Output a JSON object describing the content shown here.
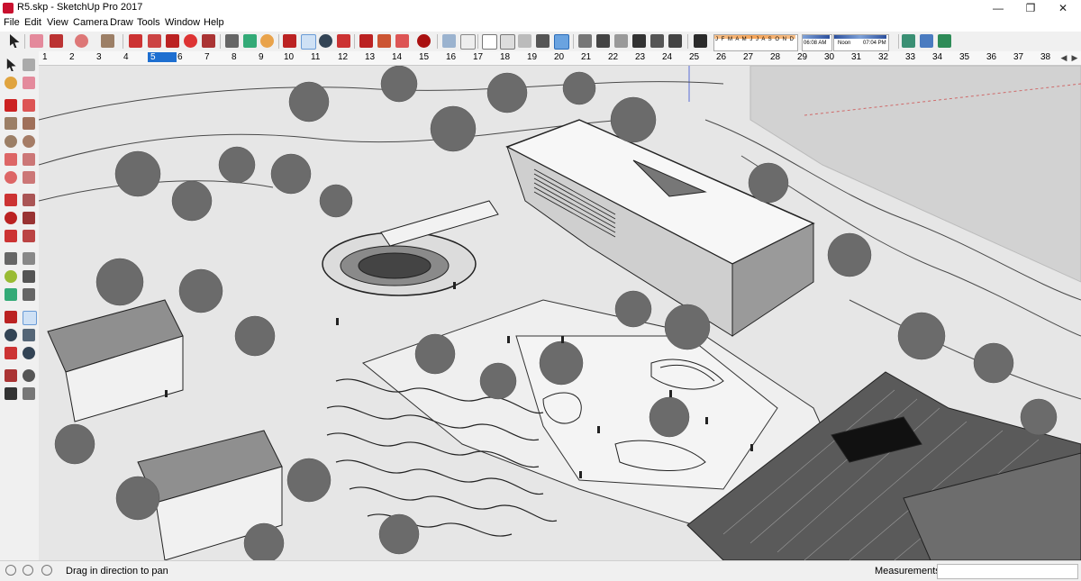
{
  "window": {
    "title": "R5.skp - SketchUp Pro 2017",
    "minimize": "—",
    "maximize": "❐",
    "close": "✕"
  },
  "menu": [
    "File",
    "Edit",
    "View",
    "Camera",
    "Draw",
    "Tools",
    "Window",
    "Help"
  ],
  "shadows": {
    "months": "J F M A M J J A S O N D",
    "time_start": "06:08 AM",
    "noon": "Noon",
    "time_end": "07:04 PM"
  },
  "ruler": {
    "ticks": [
      "1",
      "2",
      "3",
      "4",
      "5",
      "6",
      "7",
      "8",
      "9",
      "10",
      "11",
      "12",
      "13",
      "14",
      "15",
      "16",
      "17",
      "18",
      "19",
      "20",
      "21",
      "22",
      "23",
      "24",
      "25",
      "26",
      "27",
      "28",
      "29",
      "30",
      "31",
      "32",
      "33",
      "34",
      "35",
      "36",
      "37",
      "38"
    ],
    "active": "5"
  },
  "status": {
    "hint": "Drag in direction to pan",
    "measurements_label": "Measurements",
    "measurements_value": ""
  },
  "colors": {
    "accent": "#1e6fd0",
    "sky": "#ededed",
    "terrain": "#e8e8e8",
    "building_shadow": "#777777"
  },
  "icons": {
    "top": [
      "select-icon",
      "eraser-icon",
      "pencil-icon",
      "shapes-icon",
      "paint-bucket-icon",
      "move-icon",
      "push-pull-icon",
      "rotate-icon",
      "scale-icon",
      "tape-measure-icon",
      "text-icon",
      "paint-icon",
      "orbit-icon",
      "pan-icon",
      "zoom-icon",
      "zoom-extents-icon",
      "warehouse-icon",
      "extension-icon",
      "component-icon",
      "ruby-icon",
      "styles-icon",
      "xray-icon",
      "back-edges-icon",
      "wireframe-icon",
      "hidden-line-icon",
      "shaded-icon",
      "textured-icon",
      "monochrome-icon",
      "iso-view-icon",
      "top-view-icon",
      "front-view-icon",
      "right-view-icon",
      "back-view-icon",
      "left-view-icon",
      "shadow-toggle-icon",
      "section-icon",
      "share-icon",
      "download-icon"
    ],
    "left": [
      "select-icon",
      "make-component-icon",
      "paint-icon",
      "eraser-icon",
      "line-icon",
      "freehand-icon",
      "rectangle-icon",
      "rotated-rectangle-icon",
      "circle-icon",
      "polygon-icon",
      "arc-icon",
      "pie-icon",
      "arc-3pt-icon",
      "arc-2pt-icon",
      "move-icon",
      "push-pull-icon",
      "rotate-icon",
      "follow-me-icon",
      "scale-icon",
      "offset-icon",
      "tape-icon",
      "dimension-icon",
      "protractor-icon",
      "text-icon",
      "axes-icon",
      "3d-text-icon",
      "orbit-icon",
      "pan-icon",
      "zoom-icon",
      "zoom-window-icon",
      "zoom-extents-icon",
      "previous-view-icon",
      "position-camera-icon",
      "look-around-icon",
      "walk-icon",
      "section-plane-icon"
    ]
  }
}
